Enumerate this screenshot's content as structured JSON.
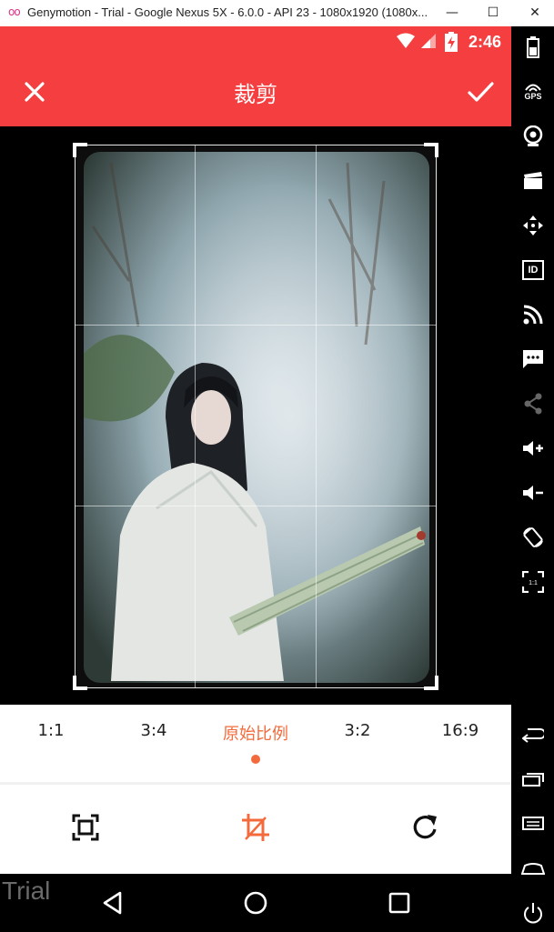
{
  "window": {
    "logo_text": "oo",
    "title": "Genymotion - Trial - Google Nexus 5X - 6.0.0 - API 23 - 1080x1920 (1080x...",
    "minimize": "—",
    "maximize": "☐",
    "close": "✕"
  },
  "sidebar": {
    "gps_label": "GPS",
    "id_label": "ID",
    "pixel_label": "1:1"
  },
  "status": {
    "time": "2:46"
  },
  "app": {
    "title": "裁剪",
    "close_icon": "close-icon",
    "confirm_icon": "check-icon"
  },
  "ratios": {
    "items": [
      {
        "label": "1:1"
      },
      {
        "label": "3:4"
      },
      {
        "label": "原始比例"
      },
      {
        "label": "3:2"
      },
      {
        "label": "16:9"
      }
    ],
    "selected": "原始比例"
  },
  "tools": {
    "items": [
      "fit-frame-icon",
      "crop-icon",
      "rotate-icon"
    ],
    "active": "crop-icon"
  },
  "colors": {
    "accent": "#f43e3f",
    "selected": "#f36b3c"
  },
  "watermark": "Trial"
}
